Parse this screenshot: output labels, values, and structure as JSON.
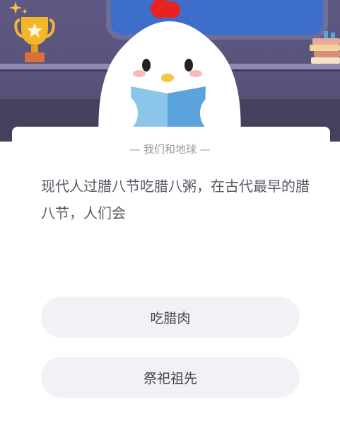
{
  "quiz": {
    "category": "— 我们和地球 —",
    "question": "现代人过腊八节吃腊八粥，在古代最早的腊八节，人们会",
    "options": [
      {
        "label": "吃腊肉"
      },
      {
        "label": "祭祀祖先"
      }
    ]
  },
  "colors": {
    "scene_bg": "#5e5983",
    "card_bg": "#ffffff",
    "option_bg": "#f1f2f5",
    "trophy": "#f5b52a",
    "comb": "#e8231f",
    "book": "#5aa3dc"
  },
  "icons": [
    "trophy-icon",
    "sparkle-icon",
    "books-icon",
    "mascot-chick"
  ]
}
